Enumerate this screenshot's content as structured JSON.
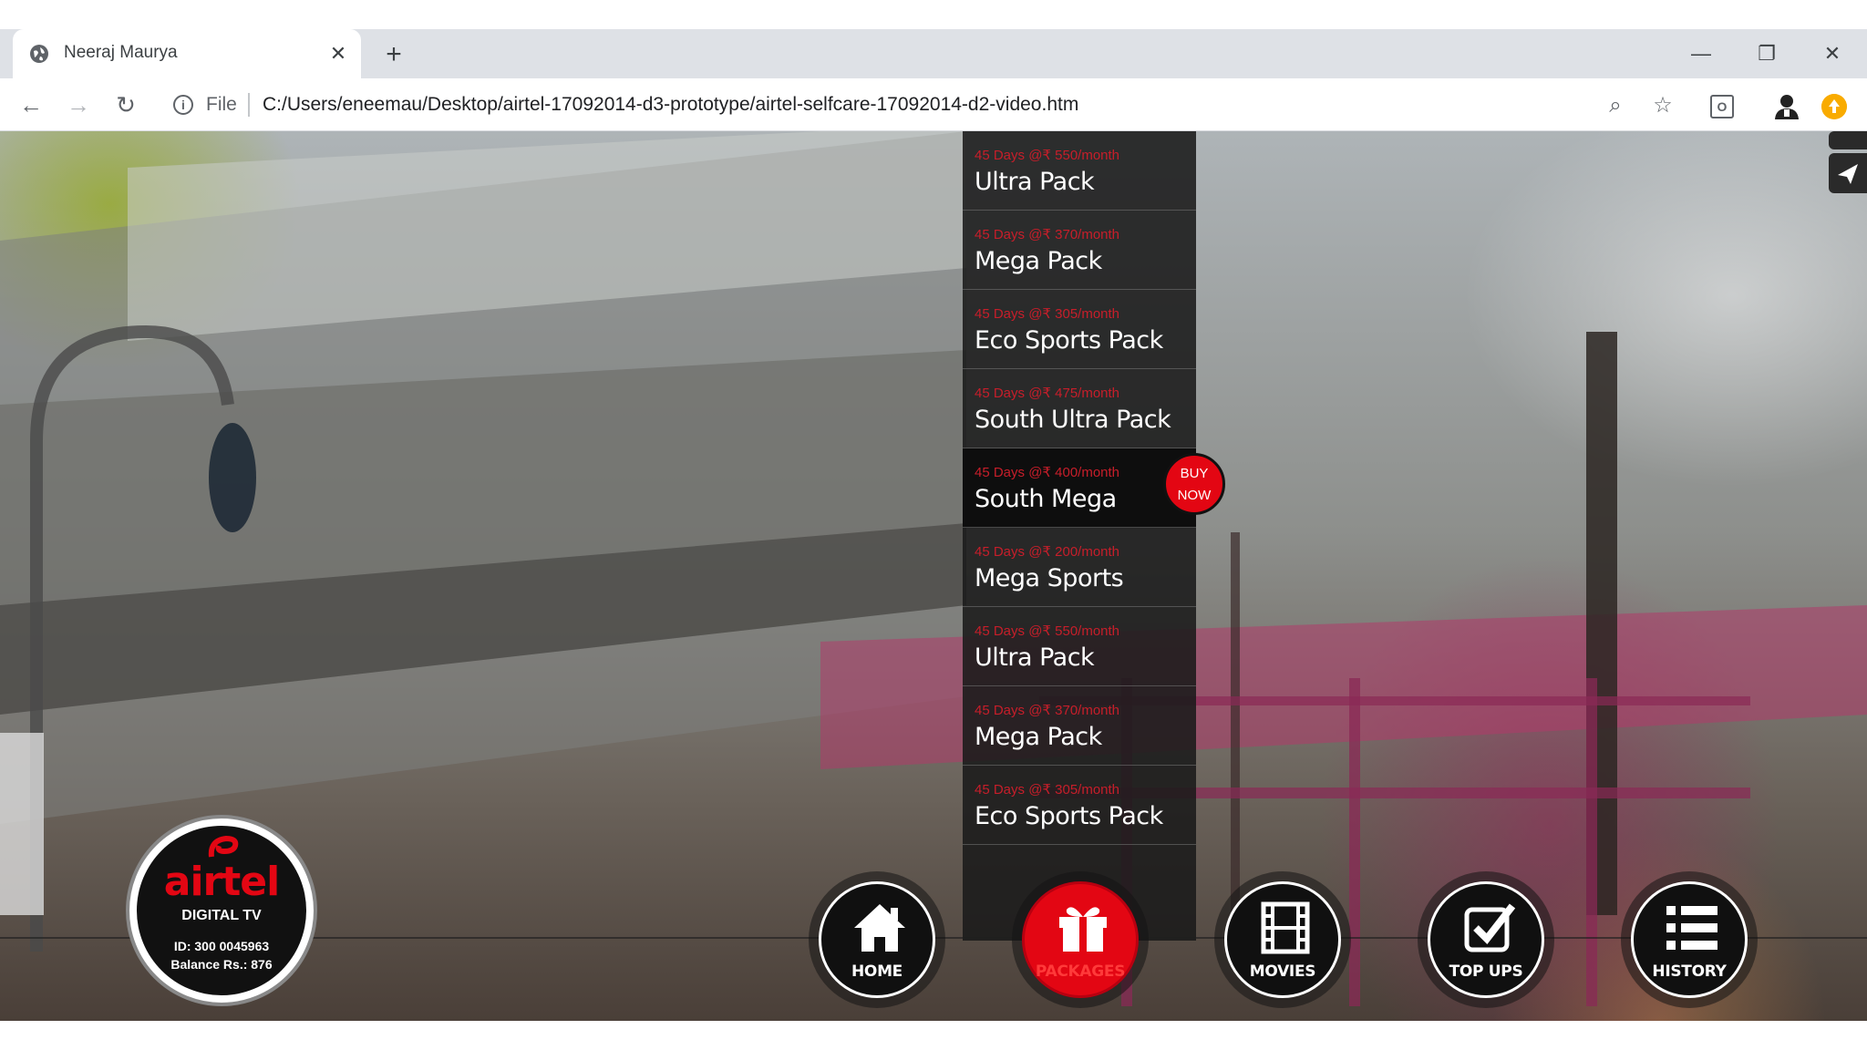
{
  "browser": {
    "tab_title": "Neeraj Maurya",
    "tab_close": "✕",
    "new_tab": "+",
    "window_minimize": "—",
    "window_restore": "❐",
    "window_close": "✕",
    "back": "←",
    "forward": "→",
    "reload": "↻",
    "info": "i",
    "scheme_label": "File",
    "url": "C:/Users/eneemau/Desktop/airtel-17092014-d3-prototype/airtel-selfcare-17092014-d2-video.htm",
    "zoom_icon": "⌕",
    "bookmark_icon": "☆",
    "extension_label": "O"
  },
  "packages": [
    {
      "price": "45 Days @₹ 550/month",
      "name": "Ultra Pack"
    },
    {
      "price": "45 Days @₹ 370/month",
      "name": "Mega Pack"
    },
    {
      "price": "45 Days @₹ 305/month",
      "name": "Eco Sports Pack"
    },
    {
      "price": "45 Days @₹ 475/month",
      "name": "South Ultra Pack"
    },
    {
      "price": "45 Days @₹ 400/month",
      "name": "South Mega",
      "active": true
    },
    {
      "price": "45 Days @₹ 200/month",
      "name": "Mega Sports"
    },
    {
      "price": "45 Days @₹ 550/month",
      "name": "Ultra Pack"
    },
    {
      "price": "45 Days @₹ 370/month",
      "name": "Mega Pack"
    },
    {
      "price": "45 Days @₹ 305/month",
      "name": "Eco Sports Pack"
    }
  ],
  "buy_now": {
    "line1": "BUY",
    "line2": "NOW"
  },
  "nav": [
    {
      "label": "HOME",
      "icon": "home-icon"
    },
    {
      "label": "PACKAGES",
      "icon": "gift-icon",
      "active": true
    },
    {
      "label": "MOVIES",
      "icon": "film-icon"
    },
    {
      "label": "TOP UPS",
      "icon": "checkbox-icon"
    },
    {
      "label": "HISTORY",
      "icon": "list-icon"
    }
  ],
  "logo": {
    "brand": "airtel",
    "product": "DIGITAL TV",
    "account_id": "ID: 300 0045963",
    "balance": "Balance Rs.: 876"
  },
  "colors": {
    "brand_red": "#e30613",
    "price_red": "#c71e2a",
    "panel_bg": "#1a1a1a",
    "chrome_bg": "#dee1e6"
  }
}
